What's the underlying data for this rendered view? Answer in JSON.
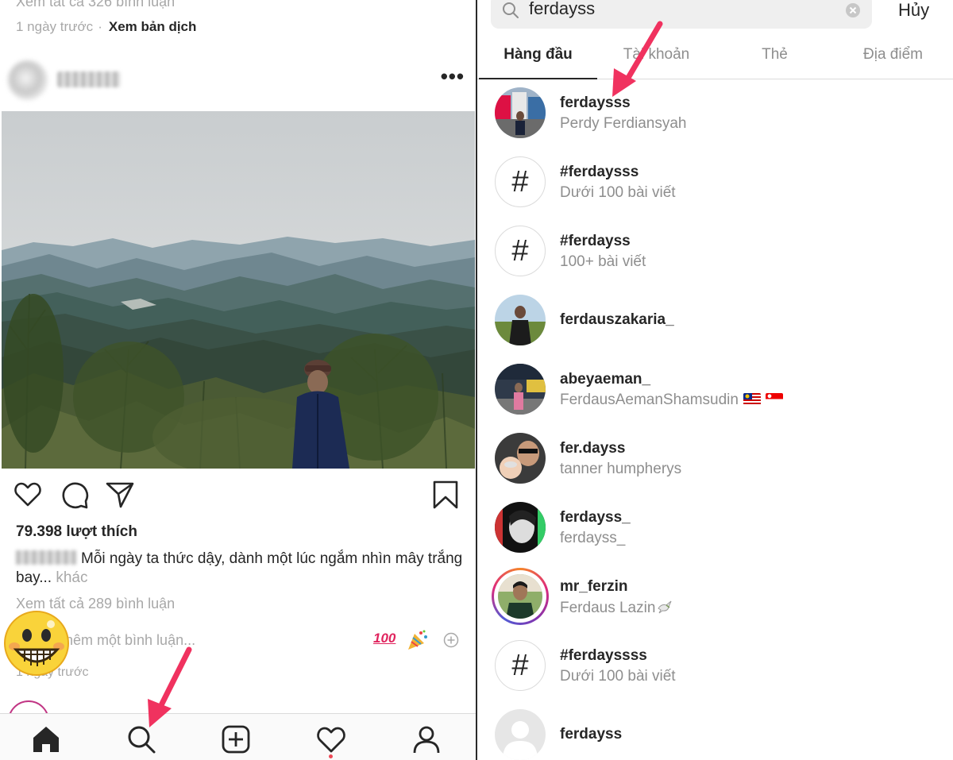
{
  "feed": {
    "prev_comments_text": "Xem tất cả 326 bình luận",
    "prev_time": "1 ngày trước",
    "prev_dot": "·",
    "translate_link": "Xem bản dịch",
    "likes": "79.398 lượt thích",
    "caption_text": "Mỗi ngày ta thức dậy, dành một lúc ngắm nhìn mây trắng bay...",
    "caption_more": "khác",
    "view_all_comments": "Xem tất cả 289 bình luận",
    "comment_placeholder": "hêm một bình luận...",
    "emoji_hundred": "100",
    "time_ago": "1 ngày trước"
  },
  "tabbar": {
    "items": [
      "home",
      "search",
      "new-post",
      "activity",
      "profile"
    ],
    "notification_color": "#ed4956"
  },
  "search": {
    "query": "ferdayss",
    "cancel_label": "Hủy",
    "tabs": [
      "Hàng đầu",
      "Tài khoản",
      "Thẻ",
      "Địa điểm"
    ],
    "active_tab": "Hàng đầu"
  },
  "results": [
    {
      "kind": "account",
      "name": "ferdaysss",
      "sub": "Perdy Ferdiansyah"
    },
    {
      "kind": "hashtag",
      "name": "#ferdaysss",
      "sub": "Dưới 100 bài viết"
    },
    {
      "kind": "hashtag",
      "name": "#ferdayss",
      "sub": "100+ bài viết"
    },
    {
      "kind": "account",
      "name": "ferdauszakaria_",
      "sub": ""
    },
    {
      "kind": "account",
      "name": "abeyaeman_",
      "sub": "FerdausAemanShamsudin"
    },
    {
      "kind": "account",
      "name": "fer.dayss",
      "sub": "tanner humpherys"
    },
    {
      "kind": "account",
      "name": "ferdayss_",
      "sub": "ferdayss_"
    },
    {
      "kind": "account",
      "name": "mr_ferzin",
      "sub": "Ferdaus Lazin"
    },
    {
      "kind": "hashtag",
      "name": "#ferdayssss",
      "sub": "Dưới 100 bài viết"
    },
    {
      "kind": "account",
      "name": "ferdayss",
      "sub": ""
    }
  ],
  "icons": {
    "hash": "#",
    "dots": "•••"
  },
  "colors": {
    "arrow": "#f0325f",
    "text_primary": "#262626",
    "text_secondary": "#8e8e8e"
  }
}
